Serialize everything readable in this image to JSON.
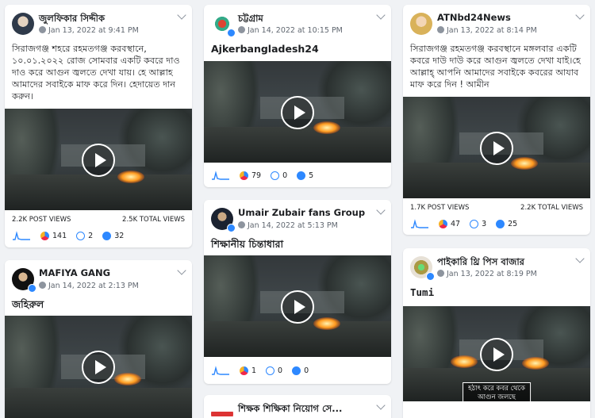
{
  "posts": [
    {
      "author": "জুলফিকার সিদ্দীক",
      "date": "Jan 13, 2022 at 9:41 PM",
      "text": "সিরাজগঞ্জ শহরে রহমতগঞ্জ করবস্থানে, ১০.০১.২০২২ রোজ সোমবার একটি কবরে দাও দাও করে আগুন জ্বলতে দেখা যায়। হে আল্লাহ আমাদের সবাইকে মাফ করে দিন। হেদায়েত দান করুন।",
      "post_views": "2.2K POST VIEWS",
      "total_views": "2.5K TOTAL VIEWS",
      "reactions": "141",
      "comments": "2",
      "shares": "32"
    },
    {
      "author": "চট্টগ্রাম",
      "date": "Jan 14, 2022 at 10:15 PM",
      "text": "Ajkerbangladesh24",
      "reactions": "79",
      "comments": "0",
      "shares": "5"
    },
    {
      "author": "ATNbd24News",
      "date": "Jan 13, 2022 at 8:14 PM",
      "text": "সিরাজগঞ্জ রহমতগঞ্জ করবস্থানে মঙ্গলবার একটি কবরে দাউ দাউ করে আগুন জ্বলতে দেখা যাই।হে আল্লাহ্ আপনি আমাদের সবাইকে কবরের আযাব মাফ করে দিন ! আমীন",
      "post_views": "1.7K POST VIEWS",
      "total_views": "2.2K TOTAL VIEWS",
      "reactions": "47",
      "comments": "3",
      "shares": "25"
    },
    {
      "author": "Umair Zubair fans Group",
      "date": "Jan 14, 2022 at 5:13 PM",
      "text": "শিক্ষানীয় চিন্তাধারা",
      "reactions": "1",
      "comments": "0",
      "shares": "0"
    },
    {
      "author": "MAFIYA GANG",
      "date": "Jan 14, 2022 at 2:13 PM",
      "text": "জহিরুল"
    },
    {
      "author": "পাইকারি থ্রি পিস বাজার",
      "date": "Jan 13, 2022 at 8:19 PM",
      "text": "Tumi",
      "video_caption_1": "হঠাৎ করে কবর থেকে",
      "video_caption_2": "আগুন জলছে"
    },
    {
      "author": "শিক্ষক শিক্ষিকা নিয়োগ সে..."
    }
  ]
}
